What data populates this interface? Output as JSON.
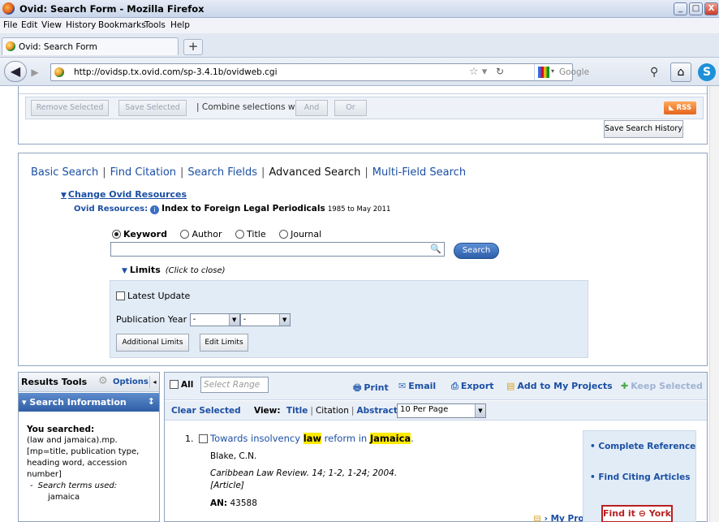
{
  "window": {
    "title": "Ovid: Search Form - Mozilla Firefox",
    "min": "_",
    "max": "□",
    "close": "X"
  },
  "menu": [
    "File",
    "Edit",
    "View",
    "History",
    "Bookmarks",
    "Tools",
    "Help"
  ],
  "tab": {
    "label": "Ovid: Search Form",
    "new_tab": "+"
  },
  "nav": {
    "url": "http://ovidsp.tx.ovid.com/sp-3.4.1b/ovidweb.cgi",
    "search_placeholder": "Google"
  },
  "history_panel": {
    "remove_selected": "Remove Selected",
    "save_selected": "Save Selected",
    "combine_label": "| Combine selections with:",
    "and": "And",
    "or": "Or",
    "rss": "RSS",
    "save_history": "Save Search History"
  },
  "search_panel": {
    "tabs": [
      "Basic Search",
      "Find Citation",
      "Search Fields",
      "Advanced Search",
      "Multi-Field Search"
    ],
    "active_tab": "Advanced Search",
    "change_resources": "Change Ovid Resources",
    "resources_label": "Ovid Resources:",
    "database": "Index to Foreign Legal Periodicals",
    "database_years": "1985 to May 2011",
    "radio_options": [
      "Keyword",
      "Author",
      "Title",
      "Journal"
    ],
    "selected_option": "Keyword",
    "keyword_value": "",
    "search_button": "Search",
    "limits_label": "Limits",
    "limits_hint": "(Click to close)",
    "latest_update": "Latest Update",
    "publication_year": "Publication Year",
    "year_from": "-",
    "year_to": "-",
    "additional_limits": "Additional Limits",
    "edit_limits": "Edit Limits"
  },
  "results_tools": {
    "title": "Results Tools",
    "options": "Options",
    "collapse": "◂",
    "search_info": "Search Information",
    "you_searched": "You searched:",
    "query_lines": [
      "(law and jamaica).mp.",
      "[mp=title, publication type,",
      "heading word, accession",
      "number]"
    ],
    "terms_label": "Search terms used:",
    "terms": [
      "jamaica"
    ]
  },
  "results": {
    "all_label": "All",
    "range_placeholder": "Select Range",
    "actions": [
      "Print",
      "Email",
      "Export",
      "Add to My Projects",
      "Keep Selected"
    ],
    "clear_selected": "Clear Selected",
    "view_label": "View:",
    "views": [
      "Title",
      "Citation",
      "Abstract"
    ],
    "per_page": "10 Per Page",
    "record": {
      "number": "1.",
      "title_parts": [
        "Towards insolvency ",
        "law",
        " reform in ",
        "Jamaica",
        "."
      ],
      "author": "Blake, C.N.",
      "source": "Caribbean Law Review. 14; 1-2, 1-24; 2004.",
      "type": "[Article]",
      "an_label": "AN:",
      "an_value": "43588",
      "my_projects": "My Projects",
      "complete_reference": "Complete Reference",
      "find_citing": "Find Citing Articles",
      "find_it": "Find it",
      "york": "York"
    }
  }
}
